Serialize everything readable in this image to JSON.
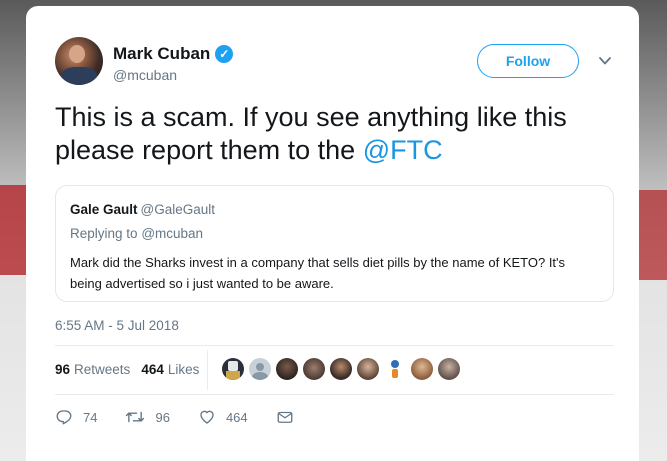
{
  "author": {
    "name": "Mark Cuban",
    "handle": "@mcuban",
    "verified": true
  },
  "follow_label": "Follow",
  "tweet": {
    "text_line1": "This is a scam.  If you see anything like this",
    "text_line2_prefix": "please report them to the ",
    "mention": "@FTC"
  },
  "quoted": {
    "name": "Gale Gault",
    "handle": "@GaleGault",
    "replying_prefix": "Replying to",
    "replying_to": "@mcuban",
    "text_line1": "Mark did the Sharks invest in a company that sells diet pills by the name of KETO? It's",
    "text_line2": "being advertised so i just wanted to be aware."
  },
  "timestamp": "6:55 AM - 5 Jul 2018",
  "stats": {
    "retweets_count": "96",
    "retweets_label": "Retweets",
    "likes_count": "464",
    "likes_label": "Likes"
  },
  "likers_count_shown": 10,
  "actions": {
    "reply_count": "74",
    "retweet_count": "96",
    "like_count": "464"
  },
  "colors": {
    "accent": "#1da1f2",
    "mention": "#1b95e0",
    "muted": "#657786",
    "text": "#14171a"
  },
  "icons": [
    "verified-badge-icon",
    "chevron-down-icon",
    "reply-icon",
    "retweet-icon",
    "heart-icon",
    "direct-message-icon"
  ]
}
